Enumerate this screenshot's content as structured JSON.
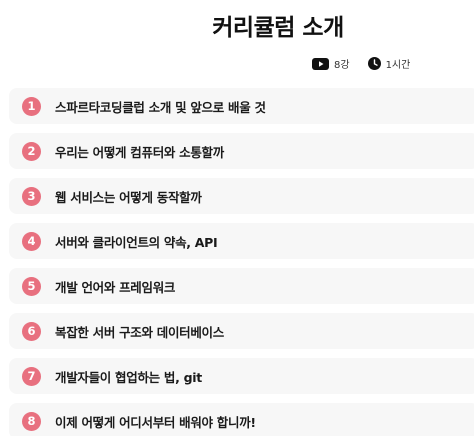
{
  "header": {
    "title": "커리큘럼 소개",
    "lectures": "8강",
    "duration": "1시간",
    "icons": {
      "lectures": "video-play-icon",
      "duration": "clock-icon"
    }
  },
  "colors": {
    "badge": "#e8707f",
    "row_bg": "#f7f7f7"
  },
  "curriculum": [
    {
      "number": "1",
      "label": "스파르타코딩클럽 소개 및 앞으로 배울 것"
    },
    {
      "number": "2",
      "label": "우리는 어떻게 컴퓨터와 소통할까"
    },
    {
      "number": "3",
      "label": "웹 서비스는 어떻게 동작할까"
    },
    {
      "number": "4",
      "label": "서버와 클라이언트의 약속, API"
    },
    {
      "number": "5",
      "label": "개발 언어와 프레임워크"
    },
    {
      "number": "6",
      "label": "복잡한 서버 구조와 데이터베이스"
    },
    {
      "number": "7",
      "label": "개발자들이 협업하는 법, git"
    },
    {
      "number": "8",
      "label": "이제 어떻게 어디서부터 배워야 합니까!"
    }
  ]
}
